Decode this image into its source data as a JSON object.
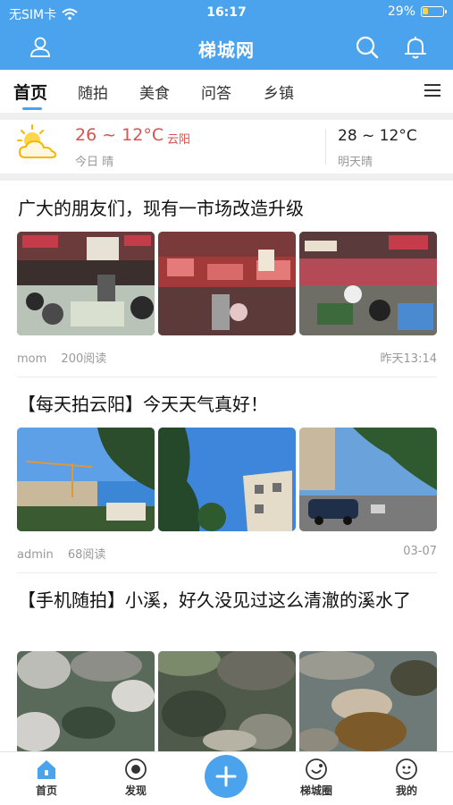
{
  "status_bar": {
    "carrier": "无SIM卡",
    "time": "16:17",
    "battery": "29%",
    "battery_level": 0.29
  },
  "header": {
    "title": "梯城网"
  },
  "tabs": [
    {
      "label": "首页",
      "active": true
    },
    {
      "label": "随拍"
    },
    {
      "label": "美食"
    },
    {
      "label": "问答"
    },
    {
      "label": "乡镇"
    }
  ],
  "weather": {
    "today_temp": "26 ~ 12°C",
    "city": "云阳",
    "today_label": "今日 晴",
    "tomorrow_temp": "28 ~ 12°C",
    "tomorrow_label": "明天晴"
  },
  "posts": [
    {
      "title": "广大的朋友们，现有一市场改造升级",
      "author": "mom",
      "reads": "200阅读",
      "time": "昨天13:14"
    },
    {
      "title": "【每天拍云阳】今天天气真好！",
      "author": "admin",
      "reads": "68阅读",
      "time": "03-07"
    },
    {
      "title": "【手机随拍】小溪，好久没见过这么清澈的溪水了"
    }
  ],
  "bottom_nav": [
    {
      "label": "首页",
      "icon": "home-icon"
    },
    {
      "label": "发现",
      "icon": "compass-icon"
    },
    {
      "label": "梯城圈",
      "icon": "circle-icon"
    },
    {
      "label": "我的",
      "icon": "profile-icon"
    }
  ],
  "colors": {
    "brand": "#4aa3ec",
    "temp_red": "#d9534f",
    "meta_gray": "#999999"
  }
}
